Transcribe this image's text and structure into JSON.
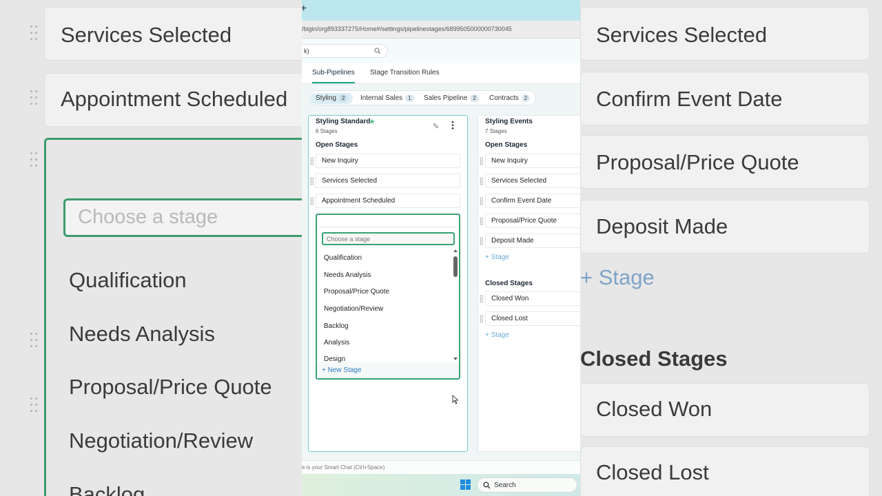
{
  "background_left": {
    "items": [
      "Services Selected",
      "Appointment Scheduled",
      "Qualification",
      "Needs Analysis",
      "Proposal/Price Quote",
      "Negotiation/Review",
      "Backlog"
    ],
    "input_placeholder": "Choose a stage"
  },
  "background_right": {
    "items": [
      "Services Selected",
      "Confirm Event Date",
      "Proposal/Price Quote",
      "Deposit Made"
    ],
    "add_stage": "+ Stage",
    "closed_title": "Closed Stages",
    "closed_items": [
      "Closed Won",
      "Closed Lost"
    ]
  },
  "browser": {
    "url": "/bigin/org893337275/Home#/settings/pipelinestages/6899505000000730045",
    "search_value": "k)"
  },
  "tabs": [
    {
      "label": "Sub-Pipelines",
      "active": true
    },
    {
      "label": "Stage Transition Rules",
      "active": false
    }
  ],
  "pipelines_filter": [
    {
      "label": "Styling",
      "count": "2",
      "active": true
    },
    {
      "label": "Internal Sales",
      "count": "1",
      "active": false
    },
    {
      "label": "Sales Pipeline",
      "count": "2",
      "active": false
    },
    {
      "label": "Contracts",
      "count": "2",
      "active": false
    }
  ],
  "pipeline_one": {
    "title": "Styling Standard",
    "subtitle": "6 Stages",
    "open_title": "Open Stages",
    "stages": [
      "New Inquiry",
      "Services Selected",
      "Appointment Scheduled"
    ]
  },
  "pipeline_two": {
    "title": "Styling Events",
    "subtitle": "7 Stages",
    "open_title": "Open Stages",
    "stages": [
      "New Inquiry",
      "Services Selected",
      "Confirm Event Date",
      "Proposal/Price Quote",
      "Deposit Made"
    ],
    "add_stage": "+ Stage",
    "closed_title": "Closed Stages",
    "closed_stages": [
      "Closed Won",
      "Closed Lost"
    ],
    "add_closed": "+ Stage"
  },
  "dropdown": {
    "placeholder": "Choose a stage",
    "options": [
      "Qualification",
      "Needs Analysis",
      "Proposal/Price Quote",
      "Negotiation/Review",
      "Backlog",
      "Analysis",
      "Design"
    ],
    "new_stage": "+ New Stage"
  },
  "chat_hint": "e is your Smart Chat (Ctrl+Space)",
  "taskbar": {
    "search_label": "Search"
  },
  "colors": {
    "accent_green": "#36a272",
    "link_blue": "#2a7bbf",
    "active_tab": "#1aa37a"
  }
}
